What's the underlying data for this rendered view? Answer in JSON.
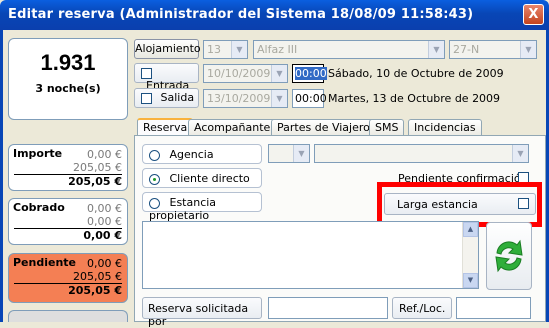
{
  "window": {
    "title": "Editar reserva  (Administrador del Sistema 18/08/09 11:58:43)",
    "close_label": "X"
  },
  "summary": {
    "amount": "1.931",
    "nights": "3 noche(s)"
  },
  "importe": {
    "label": "Importe",
    "line1": "0,00 €",
    "line2": "205,05 €",
    "total": "205,05 €"
  },
  "cobrado": {
    "label": "Cobrado",
    "line1": "0,00 €",
    "line2": "0,00 €",
    "total": "0,00 €"
  },
  "pendiente": {
    "label": "Pendiente",
    "line1": "0,00 €",
    "line2": "205,05 €",
    "total": "205,05 €",
    "color": "#f47f54"
  },
  "alojamiento": {
    "button_label": "Alojamiento",
    "number": "13",
    "name": "Alfaz III",
    "code": "27-N"
  },
  "entrada": {
    "label": "Entrada",
    "date": "10/10/2009",
    "time": "00:00",
    "description": "Sábado, 10 de Octubre de 2009"
  },
  "salida": {
    "label": "Salida",
    "date": "13/10/2009",
    "time": "00:00",
    "description": "Martes, 13 de Octubre de 2009"
  },
  "tabs": [
    {
      "label": "Reserva",
      "active": true
    },
    {
      "label": "Acompañantes",
      "active": false
    },
    {
      "label": "Partes de Viajeros",
      "active": false
    },
    {
      "label": "SMS",
      "active": false
    },
    {
      "label": "Incidencias",
      "active": false
    }
  ],
  "reserva": {
    "options": [
      {
        "label": "Agencia",
        "selected": false
      },
      {
        "label": "Cliente directo",
        "selected": true
      },
      {
        "label": "Estancia propietario",
        "selected": false
      }
    ],
    "pendiente_confirmacion_label": "Pendiente confirmación",
    "larga_estancia_label": "Larga estancia",
    "solicitada_por_label": "Reserva solicitada por",
    "ref_loc_label": "Ref./Loc.",
    "solicitada_por_value": "",
    "ref_loc_value": ""
  },
  "colors": {
    "titlebar": "#0846b6",
    "highlight": "#ff0000",
    "tab_accent": "#f9b23c"
  },
  "icons": {
    "refresh": "refresh-arrows-icon",
    "close": "close-icon"
  }
}
